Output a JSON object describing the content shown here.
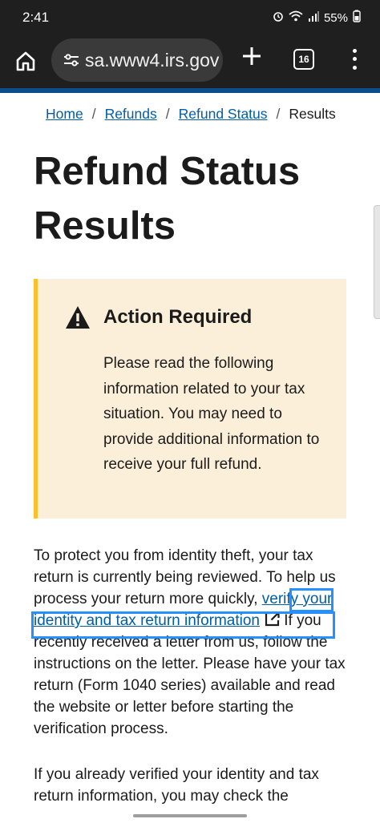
{
  "status_bar": {
    "time": "2:41",
    "battery": "55%",
    "icons": [
      "alarm-icon",
      "wifi-icon",
      "signal-icon",
      "battery-icon"
    ]
  },
  "browser": {
    "url": "sa.www4.irs.gov",
    "tab_count": "16"
  },
  "breadcrumb": {
    "items": [
      "Home",
      "Refunds",
      "Refund Status"
    ],
    "current": "Results",
    "separator": "/"
  },
  "page": {
    "title": "Refund Status Results"
  },
  "alert": {
    "title": "Action Required",
    "body": "Please read the following information related to your tax situation. You may need to provide additional information to receive your full refund.",
    "background_color": "#fcefd9",
    "accent_color": "#ffbe2e"
  },
  "content": {
    "para1_before": "To protect you from identity theft, your tax return is currently being reviewed. To help us process your return more quickly, ",
    "para1_link": "verify your identity and tax return information",
    "para1_after": " If you recently received a letter from us, follow the instructions on the letter. Please have your tax return (Form 1040 series) available and read the website or letter before starting the verification process.",
    "para2": "If you already verified your identity and tax return information, you may check the"
  },
  "colors": {
    "link": "#005ea2",
    "focus": "#2491ff",
    "header_rule": "#0b4d8c"
  }
}
